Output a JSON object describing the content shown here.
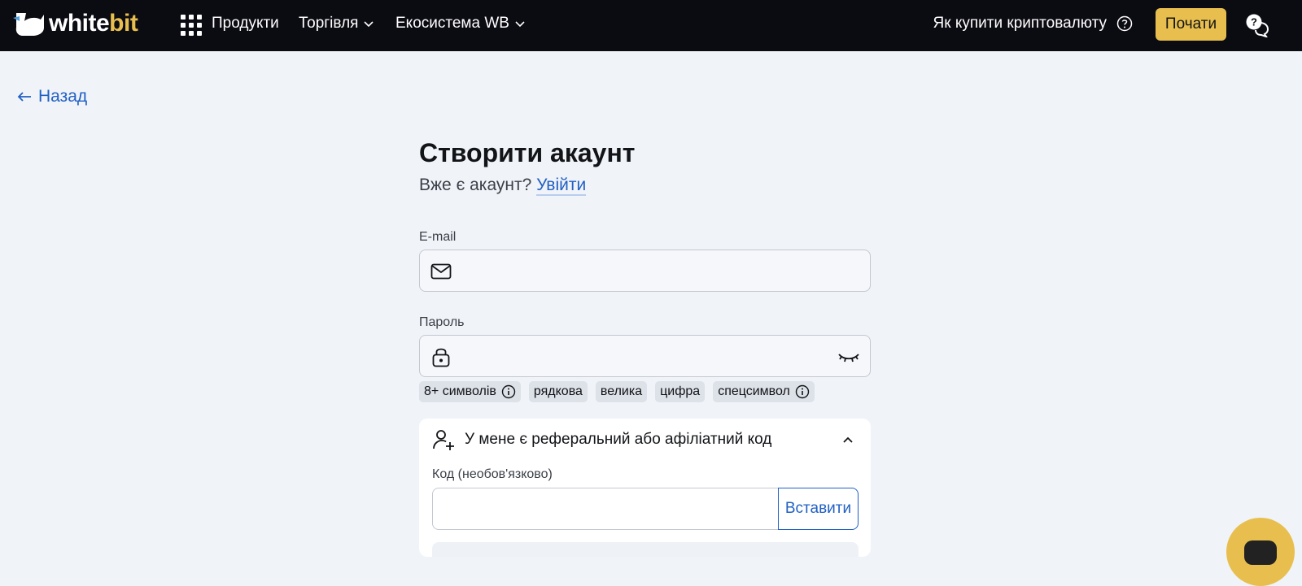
{
  "brand": {
    "logo_white": "white",
    "logo_accent": "bit"
  },
  "nav": {
    "products": "Продукти",
    "trading": "Торгівля",
    "ecosystem": "Екосистема WB",
    "how_to_buy": "Як купити криптовалюту",
    "start_button": "Почати"
  },
  "back": {
    "label": "Назад"
  },
  "form": {
    "title": "Створити акаунт",
    "have_account": "Вже є акаунт?",
    "login_link": "Увійти",
    "email_label": "E-mail",
    "email_value": "",
    "password_label": "Пароль",
    "password_value": "",
    "requirements": [
      "8+ символів",
      "рядкова",
      "велика",
      "цифра",
      "спецсимвол"
    ]
  },
  "referral": {
    "title": "У мене є реферальний або афіліатний код",
    "code_label": "Код (необов'язково)",
    "code_value": "",
    "paste_button": "Вставити"
  },
  "colors": {
    "topbar": "#0b0b12",
    "accent": "#e8bf4e",
    "link": "#2160c4",
    "background": "#f0f3f8"
  }
}
